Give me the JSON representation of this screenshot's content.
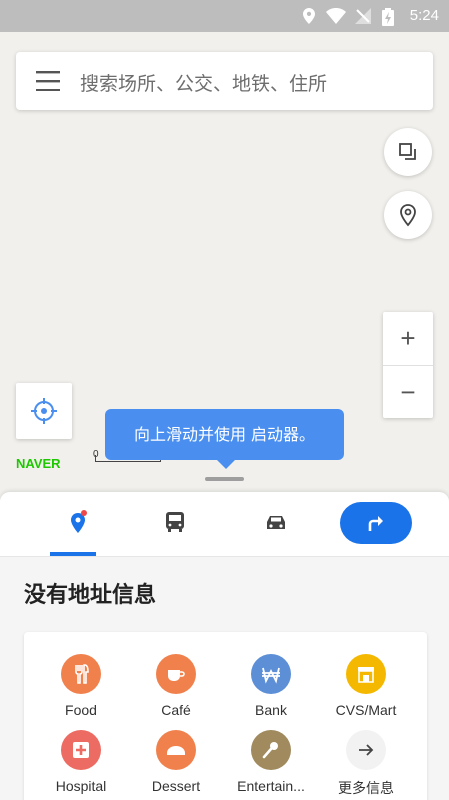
{
  "status_bar": {
    "time": "5:24"
  },
  "search": {
    "placeholder": "搜索场所、公交、地铁、住所"
  },
  "map": {
    "logo": "NAVER",
    "scale_zero": "0",
    "tooltip": "向上滑动并使用 启动器。"
  },
  "sheet": {
    "title": "没有地址信息",
    "categories": [
      {
        "label": "Food",
        "icon": "fork-knife-icon",
        "color": "#f0814d"
      },
      {
        "label": "Café",
        "icon": "cup-icon",
        "color": "#f0814d"
      },
      {
        "label": "Bank",
        "icon": "won-icon",
        "color": "#5c8fd6"
      },
      {
        "label": "CVS/Mart",
        "icon": "store-icon",
        "color": "#f5b800"
      },
      {
        "label": "Hospital",
        "icon": "hospital-icon",
        "color": "#ec6b62"
      },
      {
        "label": "Dessert",
        "icon": "dessert-icon",
        "color": "#f0814d"
      },
      {
        "label": "Entertain...",
        "icon": "microphone-icon",
        "color": "#a08a5e"
      },
      {
        "label": "更多信息",
        "icon": "arrow-right-icon",
        "color": "#f2f2f2"
      }
    ]
  },
  "colors": {
    "accent": "#1a73e8",
    "naver_green": "#1ec800"
  }
}
